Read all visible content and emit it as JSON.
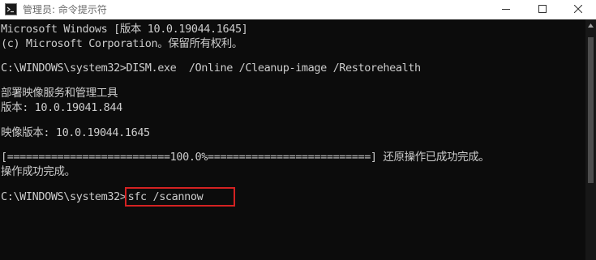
{
  "window": {
    "title": "管理员: 命令提示符"
  },
  "console": {
    "lines": [
      "Microsoft Windows [版本 10.0.19044.1645]",
      "(c) Microsoft Corporation。保留所有权利。",
      "",
      "C:\\WINDOWS\\system32>DISM.exe  /Online /Cleanup-image /Restorehealth",
      "",
      "部署映像服务和管理工具",
      "版本: 10.0.19041.844",
      "",
      "映像版本: 10.0.19044.1645",
      "",
      "[==========================100.0%==========================] 还原操作已成功完成。",
      "操作成功完成。",
      "",
      "C:\\WINDOWS\\system32>"
    ],
    "prompt": "C:\\WINDOWS\\system32>",
    "current_command": "sfc /scannow"
  },
  "icons": {
    "app": "cmd-icon",
    "minimize": "minimize-icon",
    "maximize": "maximize-icon",
    "close": "close-icon",
    "scroll_up": "scroll-up-arrow-icon"
  },
  "colors": {
    "console_bg": "#0c0c0c",
    "console_text": "#cccccc",
    "highlight_border": "#d42222",
    "titlebar_bg": "#ffffff"
  }
}
